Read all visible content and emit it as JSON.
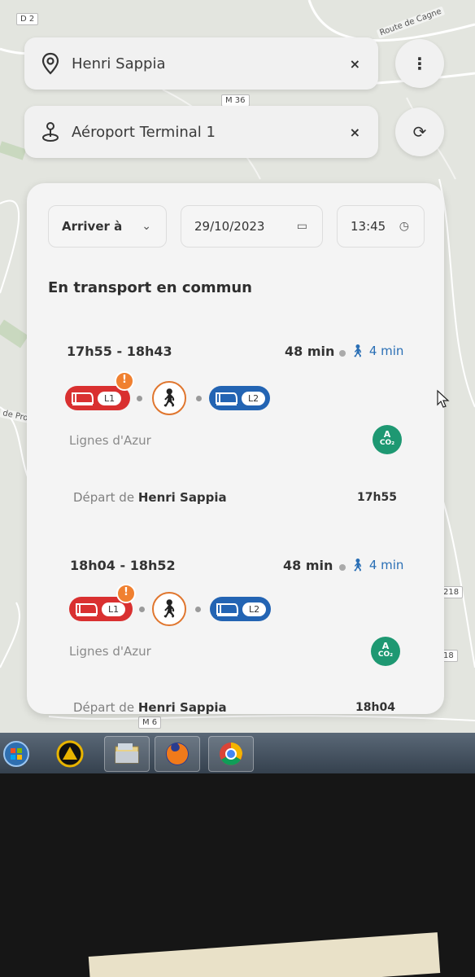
{
  "map": {
    "labels": [
      "D 2",
      "Route de Cagne",
      "M 36",
      "de Prov",
      "218",
      "18",
      "M 6"
    ]
  },
  "search": {
    "origin": {
      "value": "Henri Sappia",
      "clear_icon": "×"
    },
    "destination": {
      "value": "Aéroport Terminal 1",
      "clear_icon": "×"
    },
    "menu_icon": "⋮",
    "swap_icon": "⟳"
  },
  "filters": {
    "mode": "Arriver à",
    "date": "29/10/2023",
    "time": "13:45"
  },
  "section_title": "En transport en commun",
  "trips": [
    {
      "times": "17h55 - 18h43",
      "duration": "48 min",
      "walk": "4 min",
      "line1": "L1",
      "line2": "L2",
      "operator": "Lignes d'Azur",
      "co2_top": "A",
      "co2_bottom": "CO₂",
      "depart_prefix": "Départ de",
      "depart_stop": "Henri Sappia",
      "depart_time": "17h55"
    },
    {
      "times": "18h04 - 18h52",
      "duration": "48 min",
      "walk": "4 min",
      "line1": "L1",
      "line2": "L2",
      "operator": "Lignes d'Azur",
      "co2_top": "A",
      "co2_bottom": "CO₂",
      "depart_prefix": "Départ de",
      "depart_stop": "Henri Sappia",
      "depart_time": "18h04"
    }
  ],
  "colors": {
    "tram_l1": "#d93030",
    "tram_l2": "#2364b3",
    "walk_ring": "#e0762e",
    "co2_badge": "#1e9872",
    "walk_text": "#2a6fb5"
  },
  "taskbar": {
    "items": [
      "start-orb-icon",
      "app-icon",
      "file-explorer-icon",
      "firefox-icon",
      "chrome-icon"
    ]
  }
}
